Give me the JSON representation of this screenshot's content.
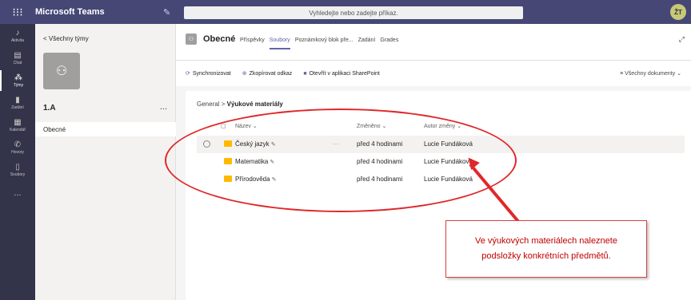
{
  "topbar": {
    "app_title": "Microsoft Teams",
    "search_placeholder": "Vyhledejte nebo zadejte příkaz.",
    "avatar_initials": "ŽT"
  },
  "rail": {
    "items": [
      {
        "label": "Aktivita",
        "icon": "bell-icon"
      },
      {
        "label": "Chat",
        "icon": "chat-icon"
      },
      {
        "label": "Týmy",
        "icon": "teams-icon"
      },
      {
        "label": "Zadání",
        "icon": "assignments-icon"
      },
      {
        "label": "Kalendář",
        "icon": "calendar-icon"
      },
      {
        "label": "Hovory",
        "icon": "phone-icon"
      },
      {
        "label": "Soubory",
        "icon": "files-icon"
      }
    ],
    "more": "..."
  },
  "panel": {
    "back_label": "< Všechny týmy",
    "team_name": "1.A",
    "team_more": "...",
    "channel": "Obecné"
  },
  "header": {
    "channel_title": "Obecné",
    "tabs": [
      "Příspěvky",
      "Soubory",
      "Poznámkový blok pře...",
      "Zadání",
      "Grades"
    ],
    "active_tab": "Soubory"
  },
  "toolbar": {
    "sync": "Synchronizovat",
    "copy_link": "Zkopírovat odkaz",
    "open_sharepoint": "Otevřít v aplikaci SharePoint",
    "all_docs": "Všechny dokumenty"
  },
  "breadcrumb": {
    "root": "General",
    "separator": ">",
    "current": "Výukové materiály"
  },
  "table": {
    "headers": {
      "name": "Název",
      "modified": "Změněno",
      "author": "Autor změny"
    },
    "rows": [
      {
        "name": "Český jazyk",
        "modified": "před 4 hodinami",
        "author": "Lucie Fundáková",
        "more": "···"
      },
      {
        "name": "Matematika",
        "modified": "před 4 hodinami",
        "author": "Lucie Fundáková"
      },
      {
        "name": "Přírodověda",
        "modified": "před 4 hodinami",
        "author": "Lucie Fundáková"
      }
    ]
  },
  "annotation": {
    "line1": "Ve výukových materiálech naleznete",
    "line2": "podsložky konkrétních předmětů.",
    "color": "#e0282a"
  }
}
